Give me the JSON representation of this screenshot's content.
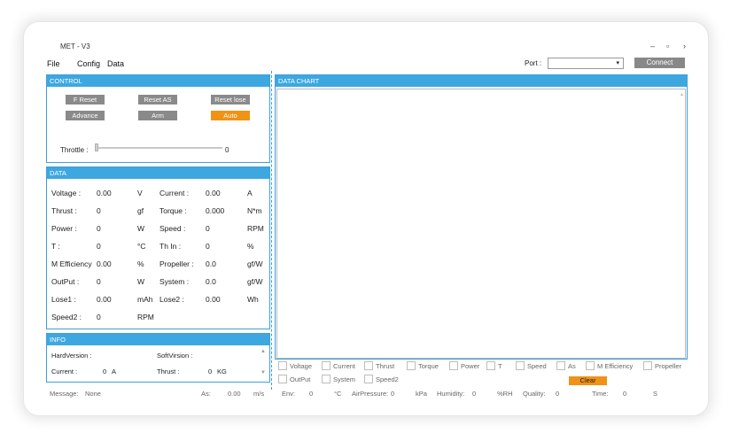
{
  "window": {
    "title": "MET - V3",
    "minimize": "–",
    "restore": "▫",
    "close": "›"
  },
  "menu": [
    {
      "label": "File"
    },
    {
      "label": "Config"
    },
    {
      "label": "Data"
    }
  ],
  "port": {
    "label": "Port :",
    "value": "",
    "arrow": "▾"
  },
  "connect_label": "Connect",
  "control": {
    "header": "CONTROL",
    "buttons": [
      {
        "label": "F Reset"
      },
      {
        "label": "Reset AS"
      },
      {
        "label": "Reset lose"
      },
      {
        "label": "Advance"
      },
      {
        "label": "Arm"
      },
      {
        "label": "Auto"
      }
    ],
    "throttle_label": "Throttle :",
    "throttle_value": "0",
    "throttle_level": 0
  },
  "data": {
    "header": "DATA",
    "rows": [
      [
        "Voltage :",
        "0.00",
        "V",
        "Current :",
        "0.00",
        "A"
      ],
      [
        "Thrust :",
        "0",
        "gf",
        "Torque :",
        "0.000",
        "N*m"
      ],
      [
        "Power :",
        "0",
        "W",
        "Speed :",
        "0",
        "RPM"
      ],
      [
        "T :",
        "0",
        "°C",
        "Th In :",
        "0",
        "%"
      ],
      [
        "M Efficiency",
        "0.00",
        "%",
        "Propeller :",
        "0.0",
        "gf/W"
      ],
      [
        "OutPut :",
        "0",
        "W",
        "System :",
        "0.0",
        "gf/W"
      ],
      [
        "Lose1 :",
        "0.00",
        "mAh",
        "Lose2 :",
        "0.00",
        "Wh"
      ],
      [
        "Speed2 :",
        "0",
        "RPM",
        "",
        "",
        ""
      ]
    ]
  },
  "info": {
    "header": "INFO",
    "hard_version_label": "HardVersion :",
    "soft_version_label": "SoftVirsion :",
    "current_label": "Current :",
    "current_value": "0",
    "current_unit": "A",
    "thrust_label": "Thrust :",
    "thrust_value": "0",
    "thrust_unit": "KG",
    "scroll_up": "▲",
    "scroll_down": "▼"
  },
  "chart": {
    "header": "DATA CHART",
    "scroll": "▴"
  },
  "series_checkboxes": [
    {
      "label": "Voltage"
    },
    {
      "label": "Current"
    },
    {
      "label": "Thrust"
    },
    {
      "label": "Torque"
    },
    {
      "label": "Power"
    },
    {
      "label": "T"
    },
    {
      "label": "Speed"
    },
    {
      "label": "As"
    },
    {
      "label": "M Efficiency"
    },
    {
      "label": "Propeller"
    },
    {
      "label": "OutPut"
    },
    {
      "label": "System"
    },
    {
      "label": "Speed2"
    }
  ],
  "clear_label": "Clear",
  "status": {
    "message_label": "Message:",
    "message_value": "None",
    "as_label": "As:",
    "as_value": "0.00",
    "as_unit": "m/s",
    "env_label": "Env:",
    "env_value": "0",
    "env_unit": "°C",
    "air_label": "AirPressure:",
    "air_value": "0",
    "air_unit": "kPa",
    "humidity_label": "Humidity:",
    "humidity_value": "0",
    "humidity_unit": "%RH",
    "quality_label": "Quality:",
    "quality_value": "0",
    "time_label": "Time:",
    "time_value": "0",
    "time_unit": "S"
  },
  "colors": {
    "accent": "#3da8e0",
    "button": "#8a8a8a",
    "active": "#ef9316"
  }
}
